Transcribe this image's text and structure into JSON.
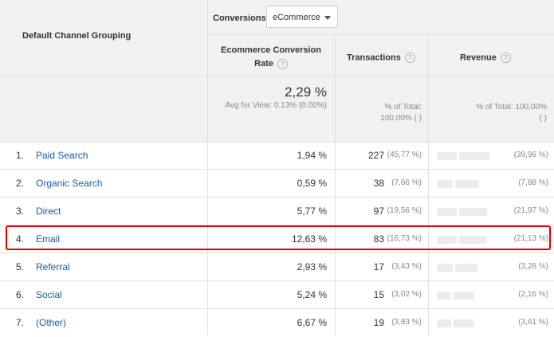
{
  "header": {
    "dimension_label": "Default Channel Grouping",
    "conversions_label": "Conversions",
    "conversions_selected": "eCommerce",
    "col_rate_line1": "Ecommerce Conversion",
    "col_rate_line2": "Rate",
    "col_transactions": "Transactions",
    "col_revenue": "Revenue",
    "help_glyph": "?"
  },
  "summary": {
    "rate_value": "2,29 %",
    "rate_avg": "Avg for View: 0.13% (0.00%)",
    "tx_total_line1": "% of Total:",
    "tx_total_line2": "100.00% (  )",
    "rev_total_line1": "% of Total: 100.00%",
    "rev_total_line2": "(               )"
  },
  "rows": [
    {
      "idx": "1.",
      "name": "Paid Search",
      "rate": "1,94 %",
      "tx": "227",
      "txpct": "(45,77 %)",
      "revpct": "(39,96 %)"
    },
    {
      "idx": "2.",
      "name": "Organic Search",
      "rate": "0,59 %",
      "tx": "38",
      "txpct": "(7,66 %)",
      "revpct": "(7,88 %)"
    },
    {
      "idx": "3.",
      "name": "Direct",
      "rate": "5,77 %",
      "tx": "97",
      "txpct": "(19,56 %)",
      "revpct": "(21,97 %)"
    },
    {
      "idx": "4.",
      "name": "Email",
      "rate": "12,63 %",
      "tx": "83",
      "txpct": "(16,73 %)",
      "revpct": "(21,13 %)"
    },
    {
      "idx": "5.",
      "name": "Referral",
      "rate": "2,93 %",
      "tx": "17",
      "txpct": "(3,43 %)",
      "revpct": "(3,28 %)"
    },
    {
      "idx": "6.",
      "name": "Social",
      "rate": "5,24 %",
      "tx": "15",
      "txpct": "(3,02 %)",
      "revpct": "(2,16 %)"
    },
    {
      "idx": "7.",
      "name": "(Other)",
      "rate": "6,67 %",
      "tx": "19",
      "txpct": "(3,83 %)",
      "revpct": "(3,61 %)"
    }
  ],
  "colors": {
    "link": "#1a5aa3",
    "highlight": "#e00000",
    "header_bg": "#f1f1f1"
  }
}
